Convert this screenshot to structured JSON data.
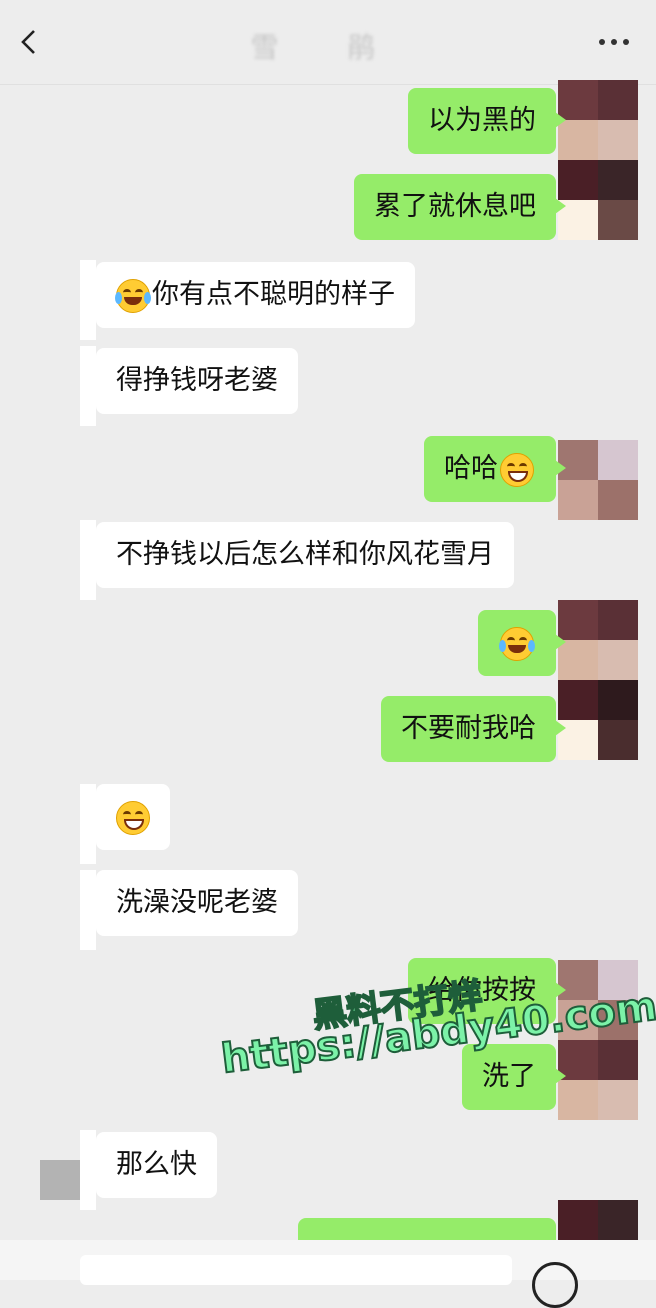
{
  "header": {
    "title": "雪 鹃",
    "back_icon": "chevron-left-icon",
    "more_icon": "more-dots-icon"
  },
  "messages": [
    {
      "side": "out",
      "text": "以为黑的"
    },
    {
      "side": "out",
      "text": "累了就休息吧"
    },
    {
      "side": "in",
      "text": "你有点不聪明的样子",
      "emoji": "tears-of-joy"
    },
    {
      "side": "in",
      "text": "得挣钱呀老婆"
    },
    {
      "side": "out",
      "text": "哈哈",
      "emoji_after": "grinning"
    },
    {
      "side": "in",
      "text": "不挣钱以后怎么样和你风花雪月"
    },
    {
      "side": "out",
      "text": "",
      "emoji": "tears-of-joy"
    },
    {
      "side": "out",
      "text": "不要耐我哈"
    },
    {
      "side": "in",
      "text": "",
      "emoji": "grin"
    },
    {
      "side": "in",
      "text": "洗澡没呢老婆"
    },
    {
      "side": "out",
      "text": "给你按按"
    },
    {
      "side": "out",
      "text": "洗了"
    },
    {
      "side": "in",
      "text": "那么快"
    }
  ],
  "watermark": {
    "line1": "黑料不打烊",
    "line2": "https://abdy40.com"
  },
  "colors": {
    "outgoing_bubble": "#95ec69",
    "incoming_bubble": "#ffffff",
    "background": "#ededed"
  }
}
